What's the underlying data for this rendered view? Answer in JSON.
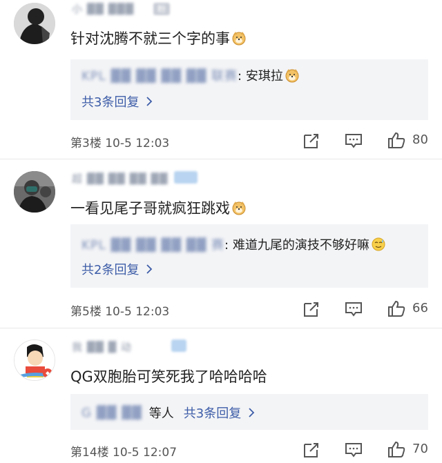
{
  "comments": [
    {
      "username": "小 ▓▓ ▓▓▓",
      "badge": "粉",
      "text": "针对沈腾不就三个字的事",
      "reply_preview": {
        "name": "KPL ▓▓ ▓▓ ▓▓ ▓▓ 联赛",
        "text": ": 安琪拉"
      },
      "more_replies": "共3条回复",
      "floor_time": "第3楼  10-5 12:03",
      "likes": "80",
      "avatar": "person-silhouette"
    },
    {
      "username": "超 ▓▓ ▓▓ ▓▓ ▓▓",
      "badge": "",
      "text": "一看见尾子哥就疯狂跳戏",
      "reply_preview": {
        "name": "KPL ▓▓ ▓▓ ▓▓ ▓▓ 赛",
        "text": ": 难道九尾的演技不够好嘛"
      },
      "more_replies": "共2条回复",
      "floor_time": "第5楼  10-5 12:03",
      "likes": "66",
      "avatar": "masked-person"
    },
    {
      "username": "我 ▓▓ ▓ 动",
      "badge": "",
      "text": "QG双胞胎可笑死我了哈哈哈哈",
      "reply_preview": {
        "name": "G ▓▓ ▓▓",
        "text": "等人"
      },
      "more_replies": "共3条回复",
      "floor_time": "第14楼  10-5 12:07",
      "likes": "70",
      "avatar": "cartoon-crayon-shin"
    }
  ],
  "colors": {
    "link": "#3d5da8",
    "reply_bg": "#f3f4f6",
    "meta": "#555555"
  }
}
